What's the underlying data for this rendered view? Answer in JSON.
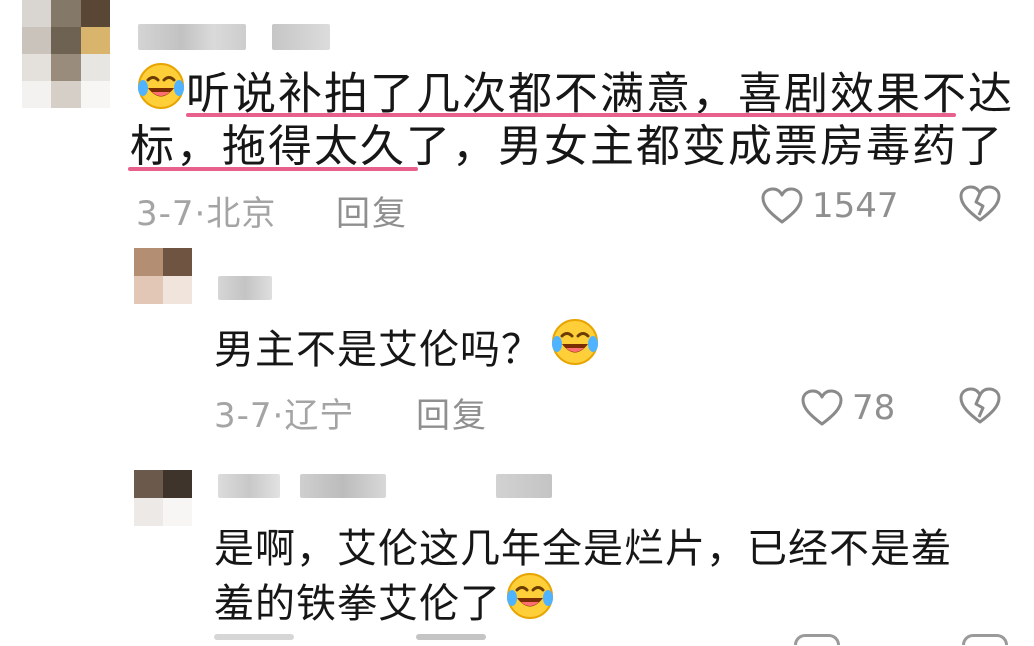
{
  "comments": [
    {
      "text_line1": "听说补拍了几次都不满意，喜剧效果不达",
      "text_line2": "标，拖得太久了，男女主都变成票房毒药了",
      "date": "3-7·北京",
      "reply_label": "回复",
      "likes": "1547",
      "leading_emoji": "laughing-crying-emoji"
    },
    {
      "text": "男主不是艾伦吗？",
      "date": "3-7·辽宁",
      "reply_label": "回复",
      "likes": "78",
      "trailing_emoji": "laughing-crying-emoji"
    },
    {
      "text_line1": "是啊，艾伦这几年全是烂片，已经不是羞",
      "text_line2": "羞的铁拳艾伦了",
      "trailing_emoji": "laughing-crying-emoji"
    }
  ],
  "colors": {
    "highlight_underline": "#e8608c",
    "meta_text": "#a4a4a4",
    "action_text": "#8f8f8f"
  },
  "icons": [
    "heart-outline-icon",
    "broken-heart-icon"
  ]
}
